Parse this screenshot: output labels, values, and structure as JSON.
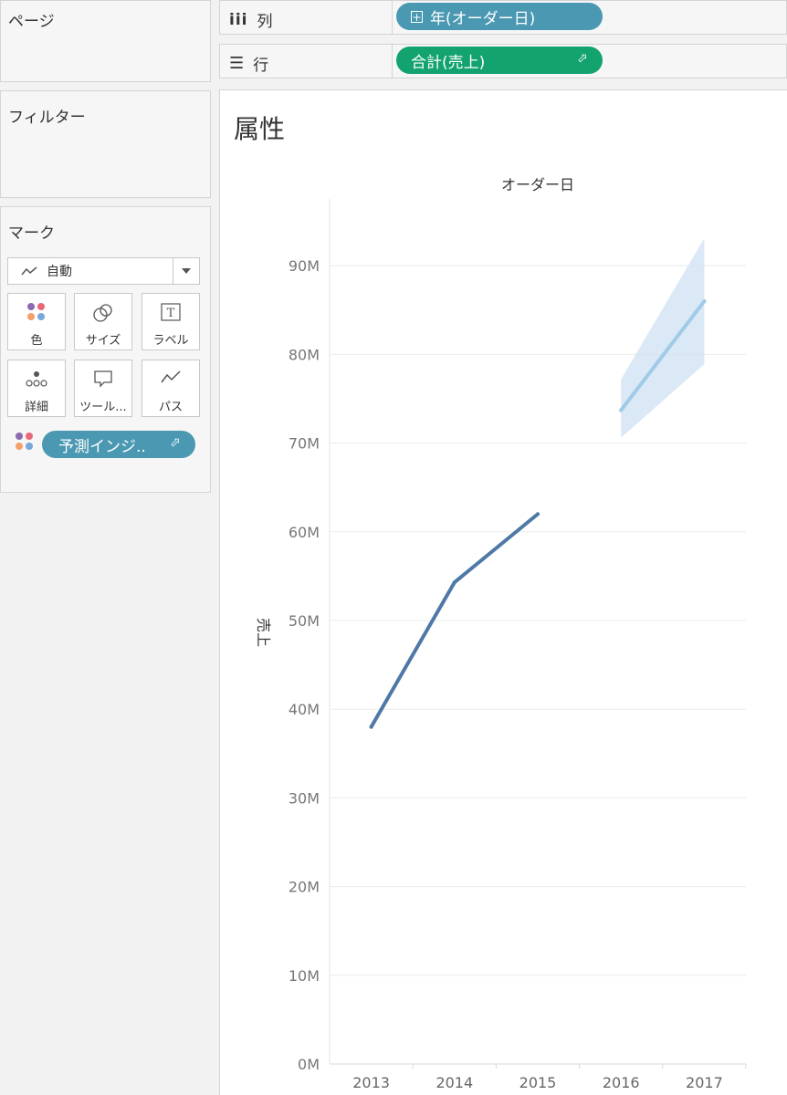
{
  "pages_panel": {
    "title": "ページ"
  },
  "filters_panel": {
    "title": "フィルター"
  },
  "marks_panel": {
    "title": "マーク",
    "mark_type": "自動",
    "buttons": [
      "色",
      "サイズ",
      "ラベル",
      "詳細",
      "ツール...",
      "パス"
    ],
    "color_field": "予測インジ.."
  },
  "columns_shelf": {
    "label": "列",
    "pill": "年(オーダー日)"
  },
  "rows_shelf": {
    "label": "行",
    "pill": "合計(売上)"
  },
  "sheet_title": "属性",
  "chart_data": {
    "type": "line",
    "title": "オーダー日",
    "ylabel": "売上",
    "xlabel": "",
    "categories": [
      "2013",
      "2014",
      "2015",
      "2016",
      "2017"
    ],
    "y_ticks": [
      "0M",
      "10M",
      "20M",
      "30M",
      "40M",
      "50M",
      "60M",
      "70M",
      "80M",
      "90M"
    ],
    "ylim": [
      0,
      100
    ],
    "grid": true,
    "series": [
      {
        "color": "#4e79a7",
        "x": [
          "2013",
          "2014",
          "2015"
        ],
        "values": [
          38,
          54.3,
          62
        ]
      },
      {
        "color": "#a0cbe8",
        "x": [
          "2016",
          "2017"
        ],
        "values": [
          73.7,
          86
        ]
      }
    ],
    "forecast_band": {
      "color": "#cfe2f3",
      "x": [
        "2016",
        "2017"
      ],
      "upper": [
        77.2,
        93.1
      ],
      "lower": [
        70.6,
        78.9
      ]
    }
  }
}
